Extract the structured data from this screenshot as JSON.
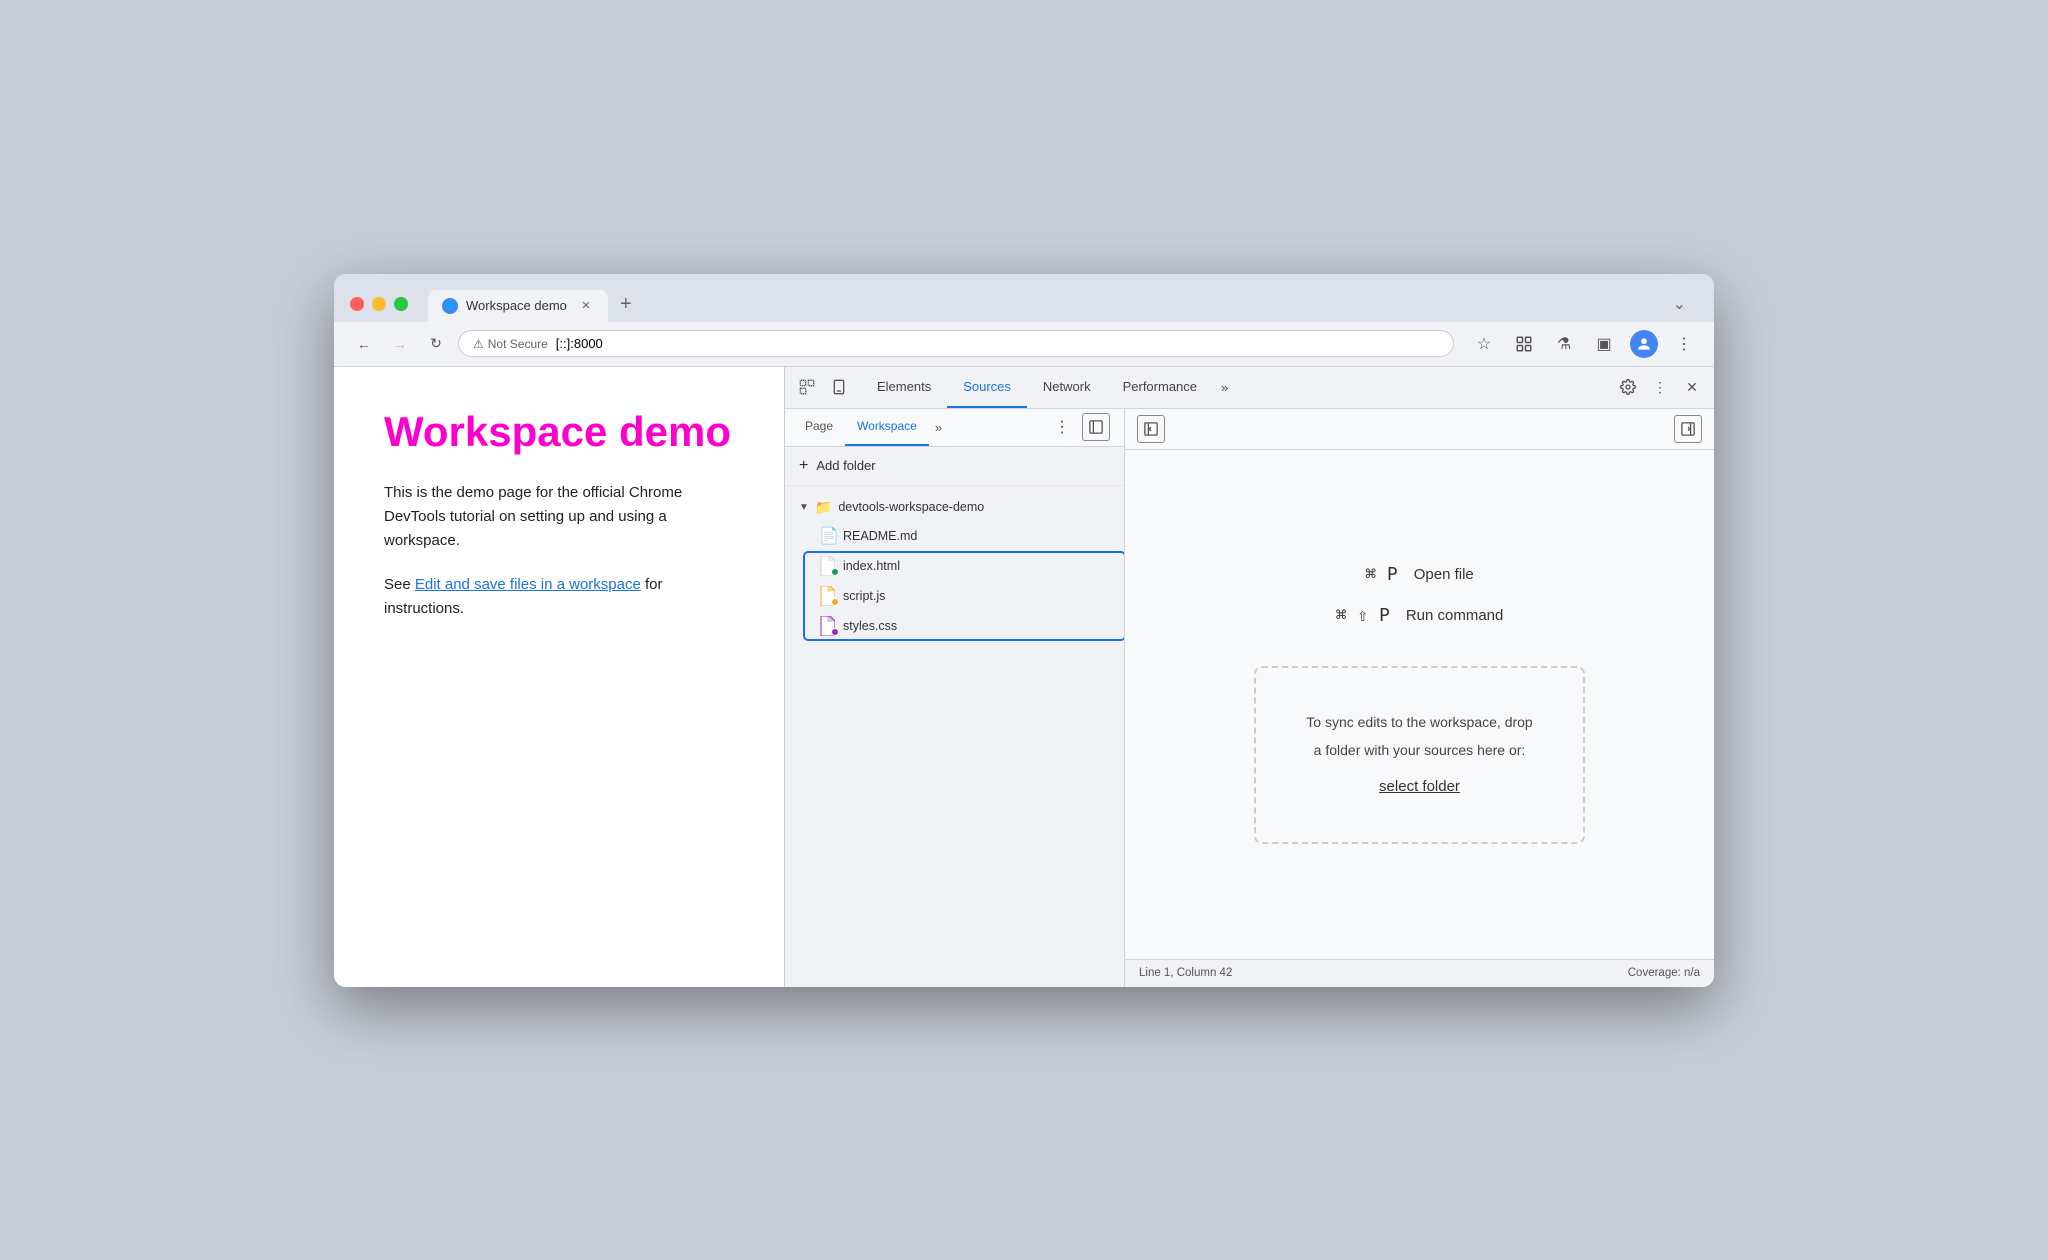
{
  "browser": {
    "tab_title": "Workspace demo",
    "tab_favicon": "🌐",
    "address_not_secure": "Not Secure",
    "address_url": "[::]:8000",
    "new_tab_label": "+",
    "tab_expand_label": "⌄"
  },
  "nav": {
    "back_disabled": false,
    "forward_disabled": true,
    "reload": "↻"
  },
  "toolbar": {
    "bookmark": "☆",
    "extensions": "🧩",
    "devtools": "⚗",
    "sidebar": "▣",
    "profile": "👤",
    "menu": "⋮"
  },
  "webpage": {
    "title": "Workspace demo",
    "description": "This is the demo page for the official Chrome DevTools tutorial on setting up and using a workspace.",
    "see_text": "See ",
    "link_text": "Edit and save files in a workspace",
    "for_text": " for instructions."
  },
  "devtools": {
    "tabs": [
      {
        "id": "elements",
        "label": "Elements",
        "active": false
      },
      {
        "id": "sources",
        "label": "Sources",
        "active": true
      },
      {
        "id": "network",
        "label": "Network",
        "active": false
      },
      {
        "id": "performance",
        "label": "Performance",
        "active": false
      },
      {
        "id": "more",
        "label": "»",
        "active": false
      }
    ],
    "subtabs": [
      {
        "id": "page",
        "label": "Page",
        "active": false
      },
      {
        "id": "workspace",
        "label": "Workspace",
        "active": true
      }
    ],
    "add_folder_label": "Add folder",
    "folder_name": "devtools-workspace-demo",
    "files": [
      {
        "name": "README.md",
        "dot": null
      },
      {
        "name": "index.html",
        "dot": "green"
      },
      {
        "name": "script.js",
        "dot": "orange"
      },
      {
        "name": "styles.css",
        "dot": "purple"
      }
    ],
    "shortcut1_keys": "⌘ P",
    "shortcut1_label": "Open file",
    "shortcut2_keys": "⌘ ⇧ P",
    "shortcut2_label": "Run command",
    "dropzone_text1": "To sync edits to the workspace, drop",
    "dropzone_text2": "a folder with your sources here or:",
    "select_folder_label": "select folder",
    "statusbar_left": "Line 1, Column 42",
    "statusbar_right": "Coverage: n/a"
  }
}
